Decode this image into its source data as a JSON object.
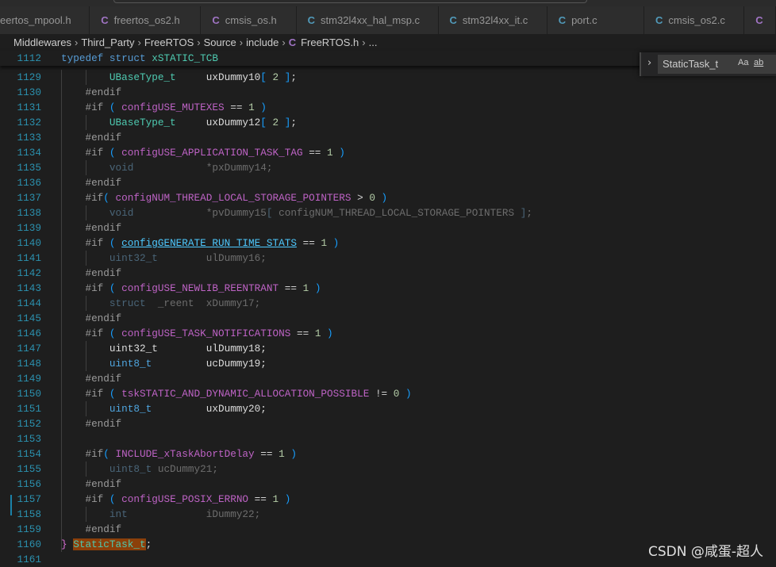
{
  "tabs": [
    {
      "label": "eertos_mpool.h",
      "icon": "c-file-icon",
      "icon_color": "#a074c4",
      "show_icon": false
    },
    {
      "label": "freertos_os2.h",
      "icon": "c-file-icon",
      "icon_color": "#a074c4",
      "show_icon": true
    },
    {
      "label": "cmsis_os.h",
      "icon": "c-file-icon",
      "icon_color": "#a074c4",
      "show_icon": true
    },
    {
      "label": "stm32l4xx_hal_msp.c",
      "icon": "c-file-icon",
      "icon_color": "#519aba",
      "show_icon": true
    },
    {
      "label": "stm32l4xx_it.c",
      "icon": "c-file-icon",
      "icon_color": "#519aba",
      "show_icon": true
    },
    {
      "label": "port.c",
      "icon": "c-file-icon",
      "icon_color": "#519aba",
      "show_icon": true
    },
    {
      "label": "cmsis_os2.c",
      "icon": "c-file-icon",
      "icon_color": "#519aba",
      "show_icon": true
    },
    {
      "label": "",
      "icon": "c-file-icon",
      "icon_color": "#a074c4",
      "show_icon": true
    }
  ],
  "tab_icon_glyph": "C",
  "breadcrumb": [
    "Middlewares",
    "Third_Party",
    "FreeRTOS",
    "Source",
    "include",
    "FreeRTOS.h",
    "..."
  ],
  "breadcrumb_sep": "›",
  "sticky": {
    "n": "1112",
    "tokens": [
      [
        "kw",
        "typedef "
      ],
      [
        "kw",
        "struct "
      ],
      [
        "ty",
        "xSTATIC_TCB"
      ]
    ]
  },
  "lines": [
    {
      "n": "1129",
      "tokens": [
        [
          "ty",
          "        UBaseType_t"
        ],
        [
          "id",
          "     uxDummy10"
        ],
        [
          "pa",
          "["
        ],
        [
          "num",
          " 2 "
        ],
        [
          "pa",
          "]"
        ],
        [
          "op",
          ";"
        ]
      ]
    },
    {
      "n": "1130",
      "tokens": [
        [
          "pp",
          "    #endif"
        ]
      ]
    },
    {
      "n": "1131",
      "tokens": [
        [
          "pp",
          "    #if "
        ],
        [
          "pa",
          "( "
        ],
        [
          "mac",
          "configUSE_MUTEXES"
        ],
        [
          "op",
          " == "
        ],
        [
          "num",
          "1"
        ],
        [
          "pa",
          " )"
        ]
      ]
    },
    {
      "n": "1132",
      "tokens": [
        [
          "ty",
          "        UBaseType_t"
        ],
        [
          "id",
          "     uxDummy12"
        ],
        [
          "pa",
          "["
        ],
        [
          "num",
          " 2 "
        ],
        [
          "pa",
          "]"
        ],
        [
          "op",
          ";"
        ]
      ]
    },
    {
      "n": "1133",
      "tokens": [
        [
          "pp",
          "    #endif"
        ]
      ]
    },
    {
      "n": "1134",
      "tokens": [
        [
          "pp",
          "    #if "
        ],
        [
          "pa",
          "( "
        ],
        [
          "mac",
          "configUSE_APPLICATION_TASK_TAG"
        ],
        [
          "op",
          " == "
        ],
        [
          "num",
          "1"
        ],
        [
          "pa",
          " )"
        ]
      ]
    },
    {
      "n": "1135",
      "tokens": [
        [
          "dimty",
          "        void"
        ],
        [
          "dim",
          "            *pxDummy14;"
        ]
      ]
    },
    {
      "n": "1136",
      "tokens": [
        [
          "pp",
          "    #endif"
        ]
      ]
    },
    {
      "n": "1137",
      "tokens": [
        [
          "pp",
          "    #if"
        ],
        [
          "pa",
          "( "
        ],
        [
          "mac",
          "configNUM_THREAD_LOCAL_STORAGE_POINTERS"
        ],
        [
          "op",
          " > "
        ],
        [
          "num",
          "0"
        ],
        [
          "pa",
          " )"
        ]
      ]
    },
    {
      "n": "1138",
      "tokens": [
        [
          "dimty",
          "        void"
        ],
        [
          "dim",
          "            *pvDummy15"
        ],
        [
          "dimty",
          "["
        ],
        [
          "dim",
          " configNUM_THREAD_LOCAL_STORAGE_POINTERS "
        ],
        [
          "dimty",
          "]"
        ],
        [
          "dim",
          ";"
        ]
      ]
    },
    {
      "n": "1139",
      "tokens": [
        [
          "pp",
          "    #endif"
        ]
      ]
    },
    {
      "n": "1140",
      "tokens": [
        [
          "pp",
          "    #if "
        ],
        [
          "pa",
          "( "
        ],
        [
          "lnk",
          "configGENERATE_RUN_TIME_STATS"
        ],
        [
          "op",
          " == "
        ],
        [
          "num",
          "1"
        ],
        [
          "pa",
          " )"
        ]
      ]
    },
    {
      "n": "1141",
      "tokens": [
        [
          "dimty",
          "        uint32_t"
        ],
        [
          "dim",
          "        ulDummy16;"
        ]
      ]
    },
    {
      "n": "1142",
      "tokens": [
        [
          "pp",
          "    #endif"
        ]
      ]
    },
    {
      "n": "1143",
      "tokens": [
        [
          "pp",
          "    #if "
        ],
        [
          "pa",
          "( "
        ],
        [
          "mac",
          "configUSE_NEWLIB_REENTRANT"
        ],
        [
          "op",
          " == "
        ],
        [
          "num",
          "1"
        ],
        [
          "pa",
          " )"
        ]
      ]
    },
    {
      "n": "1144",
      "tokens": [
        [
          "dimty",
          "        struct"
        ],
        [
          "dim",
          "  _reent  xDummy17;"
        ]
      ]
    },
    {
      "n": "1145",
      "tokens": [
        [
          "pp",
          "    #endif"
        ]
      ]
    },
    {
      "n": "1146",
      "tokens": [
        [
          "pp",
          "    #if "
        ],
        [
          "pa",
          "( "
        ],
        [
          "mac",
          "configUSE_TASK_NOTIFICATIONS"
        ],
        [
          "op",
          " == "
        ],
        [
          "num",
          "1"
        ],
        [
          "pa",
          " )"
        ]
      ]
    },
    {
      "n": "1147",
      "tokens": [
        [
          "id",
          "        uint32_t"
        ],
        [
          "id",
          "        ulDummy18;"
        ]
      ]
    },
    {
      "n": "1148",
      "tokens": [
        [
          "bt",
          "        uint8_t"
        ],
        [
          "id",
          "         ucDummy19;"
        ]
      ]
    },
    {
      "n": "1149",
      "tokens": [
        [
          "pp",
          "    #endif"
        ]
      ]
    },
    {
      "n": "1150",
      "tokens": [
        [
          "pp",
          "    #if "
        ],
        [
          "pa",
          "( "
        ],
        [
          "mac",
          "tskSTATIC_AND_DYNAMIC_ALLOCATION_POSSIBLE"
        ],
        [
          "op",
          " != "
        ],
        [
          "num",
          "0"
        ],
        [
          "pa",
          " )"
        ]
      ]
    },
    {
      "n": "1151",
      "tokens": [
        [
          "bt",
          "        uint8_t"
        ],
        [
          "id",
          "         uxDummy20;"
        ]
      ]
    },
    {
      "n": "1152",
      "tokens": [
        [
          "pp",
          "    #endif"
        ]
      ]
    },
    {
      "n": "1153",
      "tokens": []
    },
    {
      "n": "1154",
      "tokens": [
        [
          "pp",
          "    #if"
        ],
        [
          "pa",
          "( "
        ],
        [
          "mac",
          "INCLUDE_xTaskAbortDelay"
        ],
        [
          "op",
          " == "
        ],
        [
          "num",
          "1"
        ],
        [
          "pa",
          " )"
        ]
      ]
    },
    {
      "n": "1155",
      "tokens": [
        [
          "dimty",
          "        uint8_t"
        ],
        [
          "dim",
          " ucDummy21;"
        ]
      ]
    },
    {
      "n": "1156",
      "tokens": [
        [
          "pp",
          "    #endif"
        ]
      ]
    },
    {
      "n": "1157",
      "tokens": [
        [
          "pp",
          "    #if "
        ],
        [
          "pa",
          "( "
        ],
        [
          "mac",
          "configUSE_POSIX_ERRNO"
        ],
        [
          "op",
          " == "
        ],
        [
          "num",
          "1"
        ],
        [
          "pa",
          " )"
        ]
      ]
    },
    {
      "n": "1158",
      "tokens": [
        [
          "dimty",
          "        int"
        ],
        [
          "dim",
          "             iDummy22;"
        ]
      ]
    },
    {
      "n": "1159",
      "tokens": [
        [
          "pp",
          "    #endif"
        ]
      ]
    },
    {
      "n": "1160",
      "tokens": [
        [
          "br",
          "} "
        ],
        [
          "hl",
          "StaticTask_t"
        ],
        [
          "op",
          ";"
        ]
      ]
    },
    {
      "n": "1161",
      "tokens": []
    }
  ],
  "find": {
    "value": "StaticTask_t",
    "match_case": "Aa",
    "whole_word": "ab"
  },
  "watermark": "CSDN @咸蛋-超人"
}
